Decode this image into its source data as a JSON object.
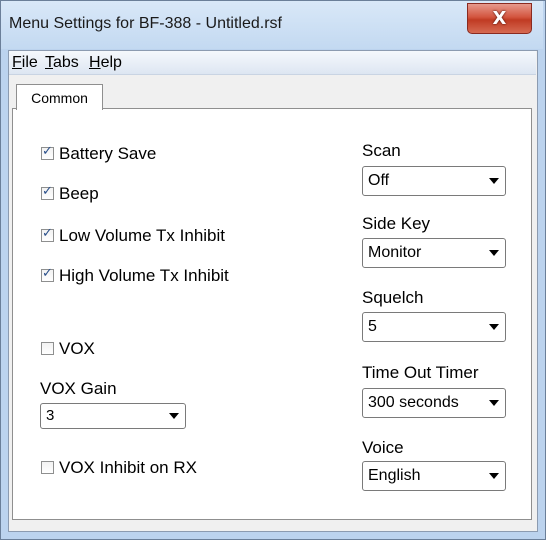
{
  "window": {
    "title": "Menu Settings for BF-388 - Untitled.rsf",
    "close_glyph": "X"
  },
  "menu": {
    "file": {
      "accel": "F",
      "rest": "ile"
    },
    "tabs": {
      "accel": "T",
      "rest": "abs"
    },
    "help": {
      "accel": "H",
      "rest": "elp"
    }
  },
  "tab": {
    "label": "Common"
  },
  "checkboxes": [
    {
      "label": "Battery Save",
      "checked": true
    },
    {
      "label": "Beep",
      "checked": true
    },
    {
      "label": "Low Volume Tx Inhibit",
      "checked": true
    },
    {
      "label": "High Volume Tx Inhibit",
      "checked": true
    },
    {
      "label": "VOX",
      "checked": false
    },
    {
      "label": "VOX Inhibit on RX",
      "checked": false
    }
  ],
  "vox_gain": {
    "label": "VOX Gain",
    "value": "3"
  },
  "scan": {
    "label": "Scan",
    "value": "Off"
  },
  "side_key": {
    "label": "Side Key",
    "value": "Monitor"
  },
  "squelch": {
    "label": "Squelch",
    "value": "5"
  },
  "time_out_timer": {
    "label": "Time Out Timer",
    "value": "300 seconds"
  },
  "voice": {
    "label": "Voice",
    "value": "English"
  },
  "colors": {
    "checkmark": "#2a4f8a",
    "close_button": "#c9462f",
    "frame": "#bcd3ee"
  }
}
